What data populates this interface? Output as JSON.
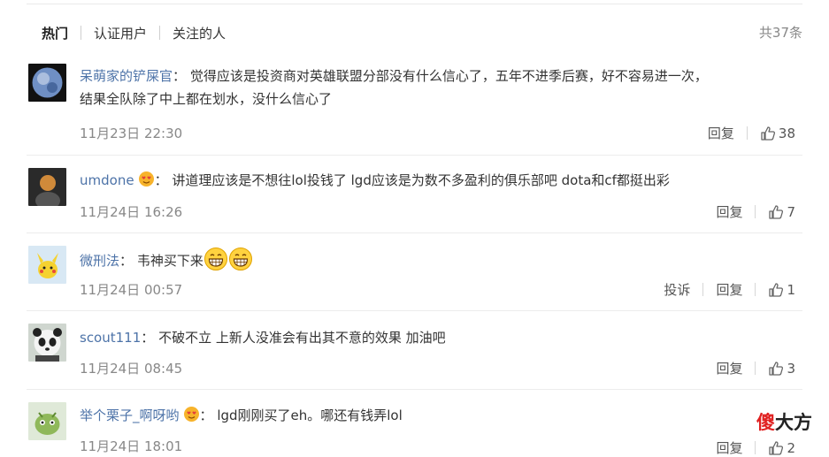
{
  "tabs": {
    "hot": "热门",
    "verified": "认证用户",
    "following": "关注的人"
  },
  "total": "共37条",
  "comments": [
    {
      "user": "呆萌家的铲屎官",
      "text": "觉得应该是投资商对英雄联盟分部没有什么信心了，五年不进季后赛，好不容易进一次，",
      "text2": "结果全队除了中上都在划水，没什么信心了",
      "time": "11月23日 22:30",
      "reply": "回复",
      "likes": "38",
      "avatar_icon": "planet-avatar"
    },
    {
      "user": "umdone",
      "text": "讲道理应该是不想往lol投钱了 lgd应该是为数不多盈利的俱乐部吧 dota和cf都挺出彩",
      "time": "11月24日 16:26",
      "reply": "回复",
      "likes": "7",
      "badge": "heart-eyes-badge-icon",
      "avatar_icon": "dark-figure-avatar"
    },
    {
      "user": "微刑法",
      "text": "韦神买下来",
      "time": "11月24日 00:57",
      "report": "投诉",
      "reply": "回复",
      "likes": "1",
      "emojis": [
        "grin-emoji-icon",
        "grin-emoji-icon"
      ],
      "avatar_icon": "pikachu-avatar"
    },
    {
      "user": "scout111",
      "text": "不破不立 上新人没准会有出其不意的效果 加油吧",
      "time": "11月24日 08:45",
      "reply": "回复",
      "likes": "3",
      "avatar_icon": "panda-avatar"
    },
    {
      "user": "举个栗子_啊呀哟",
      "text": "lgd刚刚买了eh。哪还有钱弄lol",
      "time": "11月24日 18:01",
      "reply": "回复",
      "likes": "2",
      "badge": "heart-eyes-badge-icon",
      "avatar_icon": "green-creature-avatar"
    }
  ],
  "watermark": {
    "part1": "傻",
    "part2": "大方"
  },
  "colors": {
    "link": "#4d73a8",
    "meta": "#888888",
    "watermark_red": "#e02020"
  }
}
